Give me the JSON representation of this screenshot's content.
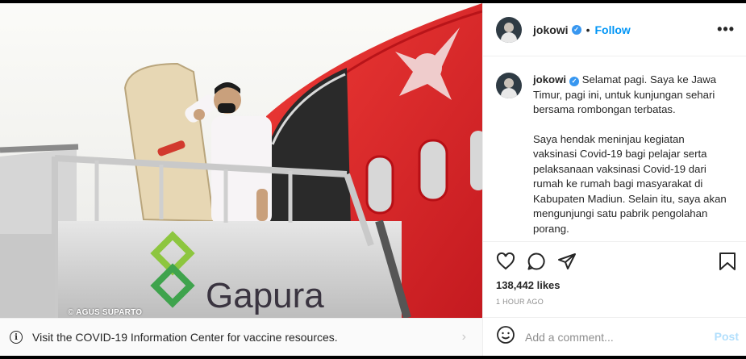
{
  "post": {
    "username": "jokowi",
    "follow_label": "Follow",
    "separator": "•",
    "more_icon": "more-horizontal-icon",
    "photo_credit": "© AGUS SUPARTO",
    "photo_signage": "Gapura",
    "caption_line1": "Selamat pagi. Saya ke Jawa Timur, pagi ini, untuk kunjungan sehari bersama rombongan terbatas.",
    "caption_line2": "Saya hendak meninjau kegiatan vaksinasi Covid-19 bagi pelajar serta pelaksanaan vaksinasi Covid-19 dari rumah ke rumah bagi masyarakat di Kabupaten Madiun. Selain itu, saya akan mengunjungi satu pabrik pengolahan porang.",
    "likes": "138,442 likes",
    "time": "1 HOUR AGO"
  },
  "covid_banner": {
    "text": "Visit the COVID-19 Information Center for vaccine resources.",
    "chevron": "›"
  },
  "comment": {
    "placeholder": "Add a comment...",
    "post_label": "Post"
  },
  "colors": {
    "link": "#0095f6",
    "verified": "#3897f0",
    "plane_red": "#e0262b"
  }
}
